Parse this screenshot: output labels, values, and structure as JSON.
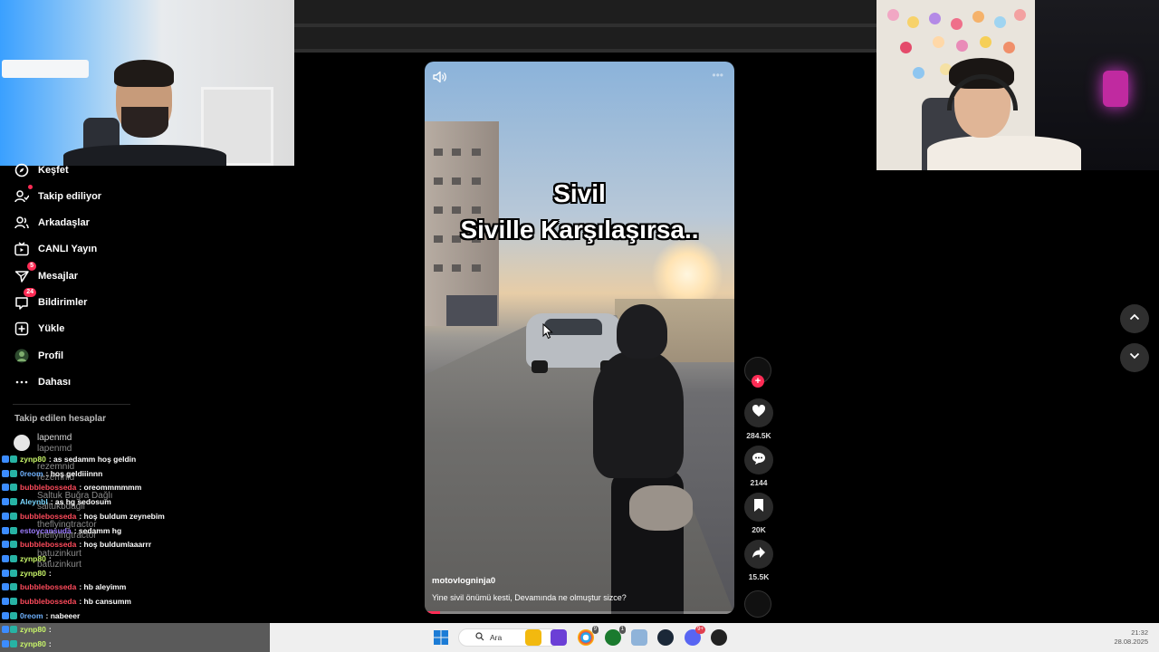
{
  "sidebar": {
    "items": [
      {
        "label": "Keşfet",
        "icon": "compass-icon"
      },
      {
        "label": "Takip ediliyor",
        "icon": "user-follow-icon"
      },
      {
        "label": "Arkadaşlar",
        "icon": "friends-icon"
      },
      {
        "label": "CANLI Yayın",
        "icon": "live-tv-icon"
      },
      {
        "label": "Mesajlar",
        "icon": "send-icon",
        "badge": "5"
      },
      {
        "label": "Bildirimler",
        "icon": "inbox-icon",
        "badge": "24"
      },
      {
        "label": "Yükle",
        "icon": "upload-plus-icon"
      },
      {
        "label": "Profil",
        "icon": "avatar-icon"
      },
      {
        "label": "Dahası",
        "icon": "more-dots-icon"
      }
    ],
    "following_title": "Takip edilen hesaplar",
    "following": [
      "lapenmd",
      "lapenmd",
      "rezemnid",
      "rezemnid",
      "Saltuk Buğra Dağlı",
      "saltukbdagli",
      "theflyingtractor",
      "theflyingtractor",
      "batuzinkurt",
      "batuzinkurt"
    ]
  },
  "chat": [
    {
      "user": "zynp80",
      "msg": ": as sedamm hoş geldin",
      "color": "#c8f56a"
    },
    {
      "user": "0reom",
      "msg": ": hoş geldiiinnn",
      "color": "#6fb2ff"
    },
    {
      "user": "bubblebosseda",
      "msg": ": oreommmmmm",
      "color": "#ff4b5c"
    },
    {
      "user": "Aleynbl",
      "msg": ": as hg sedosum",
      "color": "#7ad7ff"
    },
    {
      "user": "bubblebosseda",
      "msg": ": hoş buldum zeynebim",
      "color": "#ff4b5c"
    },
    {
      "user": "estoycansuda",
      "msg": ": sedamm hg",
      "color": "#9c7cff"
    },
    {
      "user": "bubblebosseda",
      "msg": ": hoş buldumlaaarrr",
      "color": "#ff4b5c"
    },
    {
      "user": "zynp80",
      "msg": ":",
      "color": "#c8f56a"
    },
    {
      "user": "zynp80",
      "msg": ":",
      "color": "#c8f56a"
    },
    {
      "user": "bubblebosseda",
      "msg": ": hb aleyimm",
      "color": "#ff4b5c"
    },
    {
      "user": "bubblebosseda",
      "msg": ": hb cansumm",
      "color": "#ff4b5c"
    },
    {
      "user": "0reom",
      "msg": ": nabeeer",
      "color": "#6fb2ff"
    },
    {
      "user": "zynp80",
      "msg": ":",
      "color": "#c8f56a"
    },
    {
      "user": "zynp80",
      "msg": ":",
      "color": "#c8f56a"
    }
  ],
  "video": {
    "overlay_line1": "Sivil",
    "overlay_line2": "Siville Karşılaşırsa..",
    "author": "motovlogninja0",
    "description": "Yine sivil önümü kesti, Devamında ne olmuştur sizce?",
    "progress": 0.05
  },
  "actions": {
    "likes": "284.5K",
    "comments": "2144",
    "saves": "20K",
    "shares": "15.5K"
  },
  "taskbar": {
    "search_label": "Ara",
    "time": "21:32",
    "date": "28.08.2025",
    "badges": {
      "edge": "9",
      "xbox": "1",
      "discord": "9+"
    }
  },
  "colors": {
    "accent": "#fe2c55",
    "background": "#000000"
  }
}
